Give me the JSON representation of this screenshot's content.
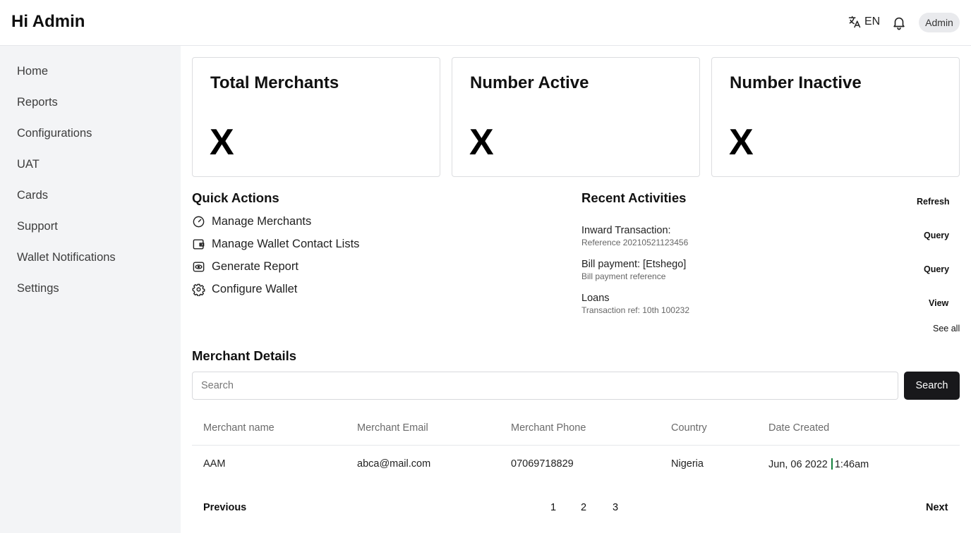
{
  "header": {
    "greeting": "Hi Admin",
    "language": "EN",
    "user": "Admin",
    "icons": [
      "translate-icon",
      "bell-icon"
    ]
  },
  "sidebar": {
    "items": [
      {
        "label": "Home"
      },
      {
        "label": "Reports"
      },
      {
        "label": "Configurations"
      },
      {
        "label": "UAT"
      },
      {
        "label": "Cards"
      },
      {
        "label": "Support"
      },
      {
        "label": "Wallet Notifications"
      },
      {
        "label": "Settings"
      }
    ]
  },
  "stats": [
    {
      "title": "Total Merchants",
      "value": "X"
    },
    {
      "title": "Number Active",
      "value": "X"
    },
    {
      "title": "Number Inactive",
      "value": "X"
    }
  ],
  "quick_actions": {
    "title": "Quick Actions",
    "items": [
      {
        "label": "Manage Merchants",
        "icon": "gauge-icon"
      },
      {
        "label": "Manage Wallet Contact Lists",
        "icon": "wallet-icon"
      },
      {
        "label": "Generate Report",
        "icon": "report-icon"
      },
      {
        "label": "Configure Wallet",
        "icon": "gear-icon"
      }
    ]
  },
  "recent_activities": {
    "title": "Recent Activities",
    "refresh_label": "Refresh",
    "see_all_label": "See all",
    "items": [
      {
        "title": "Inward Transaction:",
        "subtitle": "Reference 20210521123456",
        "action": "Query"
      },
      {
        "title": "Bill payment: [Etshego]",
        "subtitle": "Bill payment reference",
        "action": "Query"
      },
      {
        "title": "Loans",
        "subtitle": "Transaction ref: 10th 100232",
        "action": "View"
      }
    ]
  },
  "merchant_details": {
    "title": "Merchant Details",
    "search_placeholder": "Search",
    "search_button": "Search",
    "columns": [
      "Merchant name",
      "Merchant Email",
      "Merchant Phone",
      "Country",
      "Date Created"
    ],
    "rows": [
      {
        "name": "AAM",
        "email": "abca@mail.com",
        "phone": "07069718829",
        "country": "Nigeria",
        "date": "Jun, 06 2022",
        "time": "1:46am"
      }
    ]
  },
  "pagination": {
    "previous": "Previous",
    "pages": [
      "1",
      "2",
      "3"
    ],
    "next": "Next"
  },
  "colors": {
    "sidebar_bg": "#f3f4f6",
    "primary_button": "#18181b",
    "date_separator": "#15803d"
  }
}
